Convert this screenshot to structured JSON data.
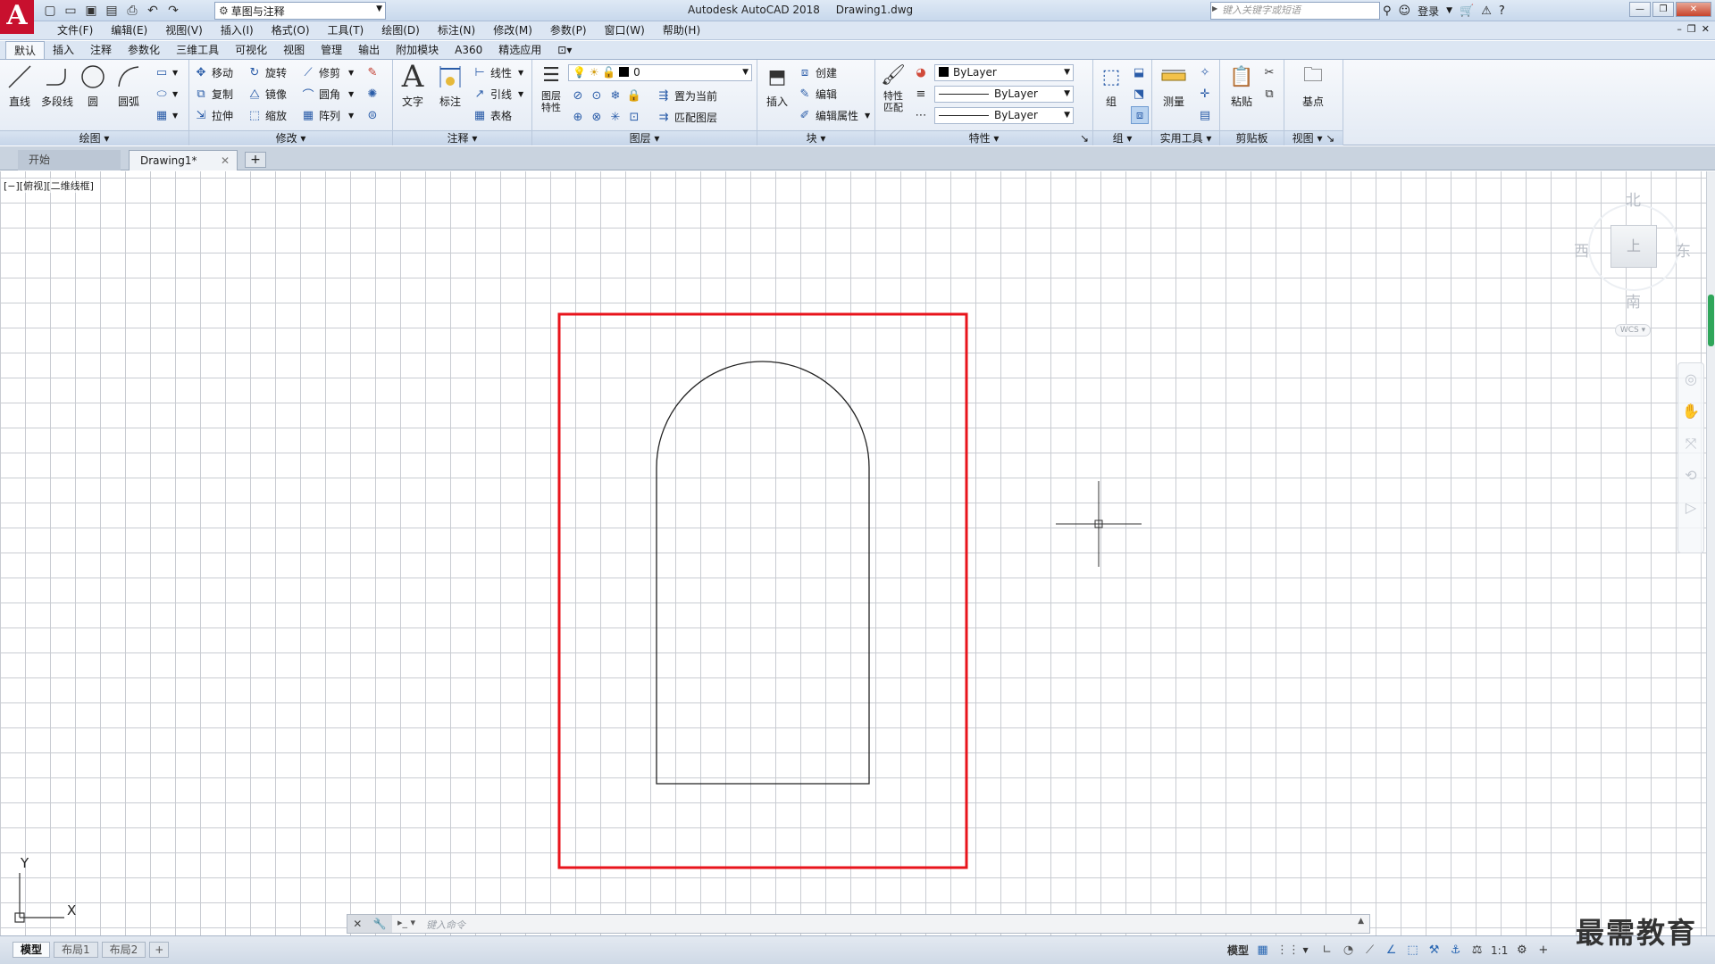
{
  "app": {
    "logo_letter": "A",
    "title": "Autodesk AutoCAD 2018",
    "file": "Drawing1.dwg",
    "workspace": "草图与注释",
    "search_placeholder": "键入关键字或短语",
    "login": "登录"
  },
  "menu": [
    "文件(F)",
    "编辑(E)",
    "视图(V)",
    "插入(I)",
    "格式(O)",
    "工具(T)",
    "绘图(D)",
    "标注(N)",
    "修改(M)",
    "参数(P)",
    "窗口(W)",
    "帮助(H)"
  ],
  "ribbon_tabs": [
    "默认",
    "插入",
    "注释",
    "参数化",
    "三维工具",
    "可视化",
    "视图",
    "管理",
    "输出",
    "附加模块",
    "A360",
    "精选应用"
  ],
  "ribbon_active_tab": "默认",
  "panels": {
    "draw": {
      "title": "绘图",
      "line": "直线",
      "polyline": "多段线",
      "circle": "圆",
      "arc": "圆弧"
    },
    "modify": {
      "title": "修改",
      "move": "移动",
      "rotate": "旋转",
      "trim": "修剪",
      "copy": "复制",
      "mirror": "镜像",
      "fillet": "圆角",
      "stretch": "拉伸",
      "scale": "缩放",
      "array": "阵列"
    },
    "annotation": {
      "title": "注释",
      "text": "文字",
      "dimension": "标注",
      "linear": "线性",
      "leader": "引线",
      "table": "表格"
    },
    "layers": {
      "title": "图层",
      "properties": "图层特性",
      "current_layer": "0",
      "set_current": "置为当前",
      "match_layer": "匹配图层"
    },
    "block": {
      "title": "块",
      "insert": "插入",
      "create": "创建",
      "edit": "编辑",
      "edit_attributes": "编辑属性"
    },
    "properties": {
      "title": "特性",
      "match": "特性匹配",
      "color": "ByLayer",
      "linetype": "ByLayer",
      "lineweight": "ByLayer"
    },
    "groups": {
      "title": "组",
      "group": "组"
    },
    "utilities": {
      "title": "实用工具",
      "measure": "测量"
    },
    "clipboard": {
      "title": "剪贴板",
      "paste": "粘贴"
    },
    "view": {
      "title": "视图",
      "base": "基点"
    }
  },
  "file_tabs": {
    "start": "开始",
    "drawing": "Drawing1*"
  },
  "viewport_label": "[−][俯视][二维线框]",
  "viewcube": {
    "north": "北",
    "south": "南",
    "east": "东",
    "west": "西",
    "face": "上",
    "wcs": "WCS"
  },
  "ucs": {
    "x": "X",
    "y": "Y"
  },
  "command": {
    "placeholder": "键入命令"
  },
  "layout_tabs": [
    "模型",
    "布局1",
    "布局2"
  ],
  "status": {
    "model": "模型",
    "scale": "1:1"
  },
  "watermark": "最需教育",
  "colors": {
    "highlight_frame": "#e8141c",
    "grid": "#c9ccd2",
    "autocad_red": "#c8102e"
  }
}
